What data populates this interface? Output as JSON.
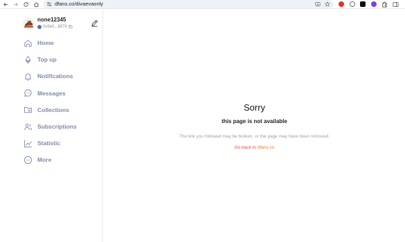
{
  "browser": {
    "url": "dfans.co/divaevaonly",
    "icons": [
      "back-icon",
      "forward-icon",
      "reload-icon",
      "home-icon",
      "site-settings-icon",
      "install-app-icon",
      "bookmark-star-icon"
    ],
    "extension_colors": [
      "#d9352c",
      "#6b6b6b",
      "#111111",
      "#7b3fe4",
      "#333333",
      "#555555"
    ]
  },
  "profile": {
    "username": "none12345",
    "wallet": "0x9e5...8878"
  },
  "sidebar": {
    "items": [
      {
        "label": "Home",
        "icon": "home-icon"
      },
      {
        "label": "Top up",
        "icon": "ethereum-icon"
      },
      {
        "label": "Notifications",
        "icon": "bell-icon"
      },
      {
        "label": "Messages",
        "icon": "chat-bubble-icon"
      },
      {
        "label": "Collections",
        "icon": "folder-star-icon"
      },
      {
        "label": "Subscriptions",
        "icon": "users-icon"
      },
      {
        "label": "Statistic",
        "icon": "chart-line-icon"
      },
      {
        "label": "More",
        "icon": "more-circle-icon"
      }
    ],
    "color": "#7f8aa6"
  },
  "error": {
    "title": "Sorry",
    "subtitle": "this page is not available",
    "description": "The link you followed may be broken, or the page may have been removed.",
    "go_back_text": "Go back to ",
    "go_back_link": "dfans.co"
  }
}
